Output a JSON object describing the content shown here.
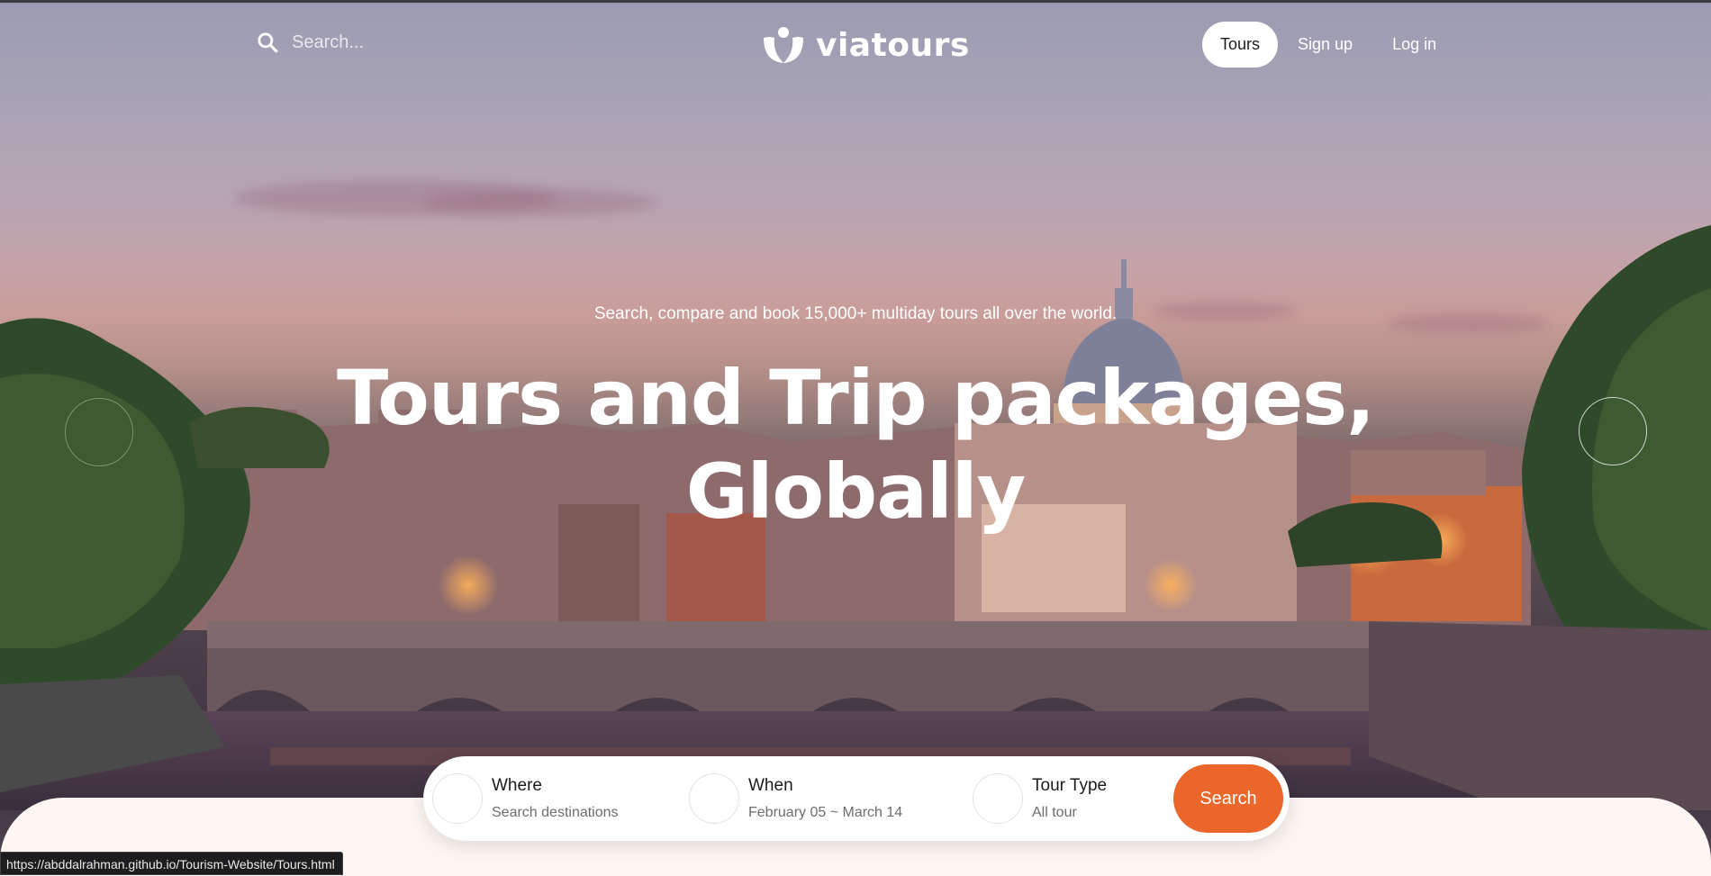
{
  "search": {
    "placeholder": "Search..."
  },
  "logo": {
    "brand": "viatours"
  },
  "nav": {
    "items": [
      {
        "label": "Tours",
        "active": true
      },
      {
        "label": "Sign up",
        "active": false
      },
      {
        "label": "Log in",
        "active": false
      }
    ]
  },
  "hero": {
    "tagline": "Search, compare and book 15,000+ multiday tours all over the world.",
    "headline_line1": "Tours and Trip packages,",
    "headline_line2": "Globally"
  },
  "searchbar": {
    "where": {
      "label": "Where",
      "value": "Search destinations"
    },
    "when": {
      "label": "When",
      "value": "February 05 ~ March 14"
    },
    "type": {
      "label": "Tour Type",
      "value": "All tour"
    },
    "button": "Search"
  },
  "status": {
    "url": "https://abddalrahman.github.io/Tourism-Website/Tours.html"
  },
  "colors": {
    "accent": "#eb662b",
    "panel": "#fdf6f3"
  },
  "icons": {
    "search": "search-icon",
    "logo": "viatours-logo-icon",
    "prev": "carousel-prev-arrow",
    "next": "carousel-next-arrow"
  }
}
